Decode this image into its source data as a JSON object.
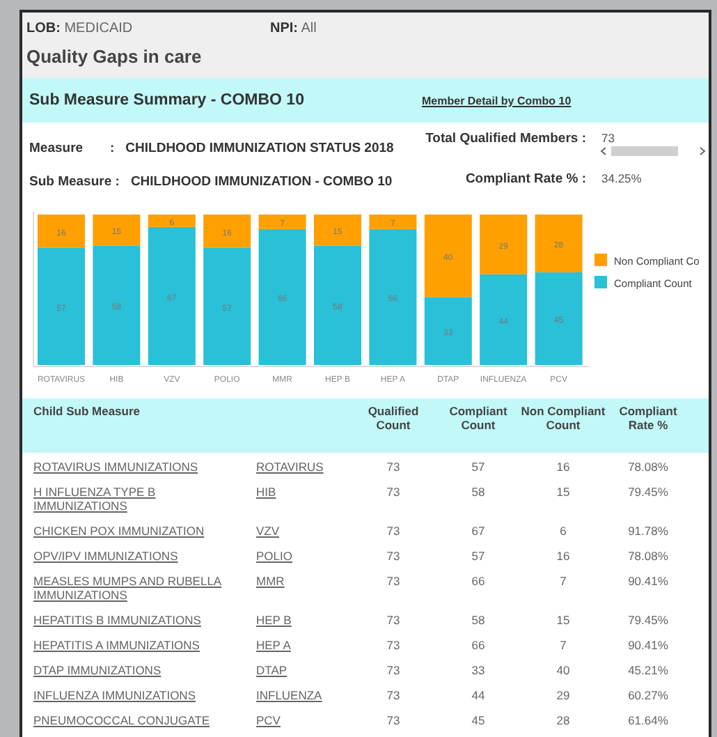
{
  "filters": [
    {
      "label": "LOB:",
      "value": "MEDICAID"
    },
    {
      "label": "NPI:",
      "value": "All"
    }
  ],
  "page_title": "Quality Gaps in care",
  "summary": {
    "title": "Sub Measure Summary - COMBO 10",
    "link": "Member Detail by Combo 10",
    "measure_label": "Measure",
    "measure_sep": ":",
    "measure": "CHILDHOOD IMMUNIZATION STATUS 2018",
    "sub_measure_label": "Sub Measure :",
    "sub_measure": "CHILDHOOD IMMUNIZATION - COMBO 10",
    "total_label": "Total Qualified Members :",
    "total": "73",
    "rate_label": "Compliant Rate % :",
    "rate": "34.25%",
    "chart_data": {
      "type": "bar",
      "stacked": true,
      "data_labels": true,
      "legend": "right",
      "categories": [
        "ROTAVIRUS",
        "HIB",
        "VZV",
        "POLIO",
        "MMR",
        "HEP B",
        "HEP A",
        "DTAP",
        "INFLUENZA",
        "PCV"
      ],
      "series": [
        {
          "name": "Compliant Count",
          "color": "#29c0d8",
          "values": [
            57,
            58,
            67,
            57,
            66,
            58,
            66,
            33,
            44,
            45
          ]
        },
        {
          "name": "Non Compliant Co",
          "color": "#ffa000",
          "values": [
            16,
            15,
            6,
            16,
            7,
            15,
            7,
            40,
            29,
            28
          ]
        }
      ]
    }
  },
  "table": {
    "columns": [
      "Child Sub Measure",
      "Qualified Count",
      "Compliant Count",
      "Non Compliant Count",
      "Compliant Rate %"
    ],
    "rows": [
      {
        "measure": "ROTAVIRUS IMMUNIZATIONS",
        "code": "ROTAVIRUS",
        "qualified": "73",
        "compliant": "57",
        "non_compliant": "16",
        "rate": "78.08%"
      },
      {
        "measure": "H INFLUENZA TYPE B IMMUNIZATIONS",
        "code": "HIB",
        "qualified": "73",
        "compliant": "58",
        "non_compliant": "15",
        "rate": "79.45%"
      },
      {
        "measure": "CHICKEN POX IMMUNIZATION",
        "code": "VZV",
        "qualified": "73",
        "compliant": "67",
        "non_compliant": "6",
        "rate": "91.78%"
      },
      {
        "measure": "OPV/IPV IMMUNIZATIONS",
        "code": "POLIO",
        "qualified": "73",
        "compliant": "57",
        "non_compliant": "16",
        "rate": "78.08%"
      },
      {
        "measure": "MEASLES MUMPS AND RUBELLA IMMUNIZATIONS",
        "code": "MMR",
        "qualified": "73",
        "compliant": "66",
        "non_compliant": "7",
        "rate": "90.41%"
      },
      {
        "measure": "HEPATITIS B IMMUNIZATIONS",
        "code": "HEP B",
        "qualified": "73",
        "compliant": "58",
        "non_compliant": "15",
        "rate": "79.45%"
      },
      {
        "measure": "HEPATITIS A IMMUNIZATIONS",
        "code": "HEP A",
        "qualified": "73",
        "compliant": "66",
        "non_compliant": "7",
        "rate": "90.41%"
      },
      {
        "measure": "DTAP IMMUNIZATIONS",
        "code": "DTAP",
        "qualified": "73",
        "compliant": "33",
        "non_compliant": "40",
        "rate": "45.21%"
      },
      {
        "measure": "INFLUENZA IMMUNIZATIONS",
        "code": "INFLUENZA",
        "qualified": "73",
        "compliant": "44",
        "non_compliant": "29",
        "rate": "60.27%"
      },
      {
        "measure": "PNEUMOCOCCAL CONJUGATE",
        "code": "PCV",
        "qualified": "73",
        "compliant": "45",
        "non_compliant": "28",
        "rate": "61.64%"
      }
    ]
  }
}
